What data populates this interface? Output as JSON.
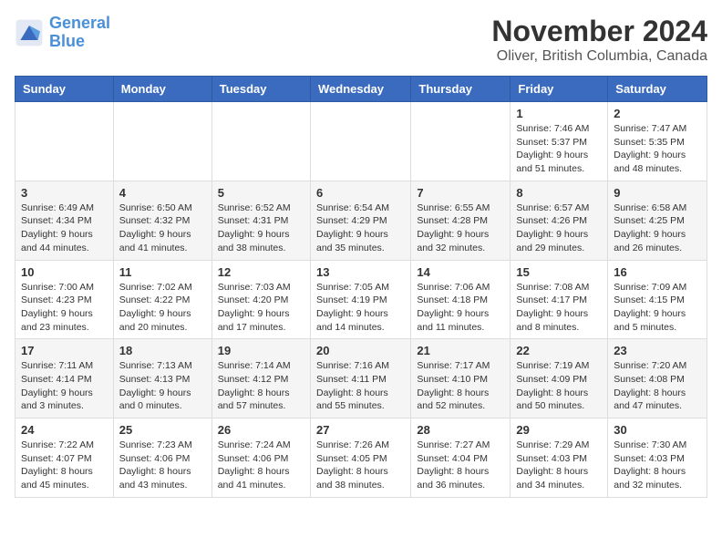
{
  "header": {
    "logo_line1": "General",
    "logo_line2": "Blue",
    "month": "November 2024",
    "location": "Oliver, British Columbia, Canada"
  },
  "weekdays": [
    "Sunday",
    "Monday",
    "Tuesday",
    "Wednesday",
    "Thursday",
    "Friday",
    "Saturday"
  ],
  "weeks": [
    [
      {
        "day": "",
        "info": ""
      },
      {
        "day": "",
        "info": ""
      },
      {
        "day": "",
        "info": ""
      },
      {
        "day": "",
        "info": ""
      },
      {
        "day": "",
        "info": ""
      },
      {
        "day": "1",
        "info": "Sunrise: 7:46 AM\nSunset: 5:37 PM\nDaylight: 9 hours\nand 51 minutes."
      },
      {
        "day": "2",
        "info": "Sunrise: 7:47 AM\nSunset: 5:35 PM\nDaylight: 9 hours\nand 48 minutes."
      }
    ],
    [
      {
        "day": "3",
        "info": "Sunrise: 6:49 AM\nSunset: 4:34 PM\nDaylight: 9 hours\nand 44 minutes."
      },
      {
        "day": "4",
        "info": "Sunrise: 6:50 AM\nSunset: 4:32 PM\nDaylight: 9 hours\nand 41 minutes."
      },
      {
        "day": "5",
        "info": "Sunrise: 6:52 AM\nSunset: 4:31 PM\nDaylight: 9 hours\nand 38 minutes."
      },
      {
        "day": "6",
        "info": "Sunrise: 6:54 AM\nSunset: 4:29 PM\nDaylight: 9 hours\nand 35 minutes."
      },
      {
        "day": "7",
        "info": "Sunrise: 6:55 AM\nSunset: 4:28 PM\nDaylight: 9 hours\nand 32 minutes."
      },
      {
        "day": "8",
        "info": "Sunrise: 6:57 AM\nSunset: 4:26 PM\nDaylight: 9 hours\nand 29 minutes."
      },
      {
        "day": "9",
        "info": "Sunrise: 6:58 AM\nSunset: 4:25 PM\nDaylight: 9 hours\nand 26 minutes."
      }
    ],
    [
      {
        "day": "10",
        "info": "Sunrise: 7:00 AM\nSunset: 4:23 PM\nDaylight: 9 hours\nand 23 minutes."
      },
      {
        "day": "11",
        "info": "Sunrise: 7:02 AM\nSunset: 4:22 PM\nDaylight: 9 hours\nand 20 minutes."
      },
      {
        "day": "12",
        "info": "Sunrise: 7:03 AM\nSunset: 4:20 PM\nDaylight: 9 hours\nand 17 minutes."
      },
      {
        "day": "13",
        "info": "Sunrise: 7:05 AM\nSunset: 4:19 PM\nDaylight: 9 hours\nand 14 minutes."
      },
      {
        "day": "14",
        "info": "Sunrise: 7:06 AM\nSunset: 4:18 PM\nDaylight: 9 hours\nand 11 minutes."
      },
      {
        "day": "15",
        "info": "Sunrise: 7:08 AM\nSunset: 4:17 PM\nDaylight: 9 hours\nand 8 minutes."
      },
      {
        "day": "16",
        "info": "Sunrise: 7:09 AM\nSunset: 4:15 PM\nDaylight: 9 hours\nand 5 minutes."
      }
    ],
    [
      {
        "day": "17",
        "info": "Sunrise: 7:11 AM\nSunset: 4:14 PM\nDaylight: 9 hours\nand 3 minutes."
      },
      {
        "day": "18",
        "info": "Sunrise: 7:13 AM\nSunset: 4:13 PM\nDaylight: 9 hours\nand 0 minutes."
      },
      {
        "day": "19",
        "info": "Sunrise: 7:14 AM\nSunset: 4:12 PM\nDaylight: 8 hours\nand 57 minutes."
      },
      {
        "day": "20",
        "info": "Sunrise: 7:16 AM\nSunset: 4:11 PM\nDaylight: 8 hours\nand 55 minutes."
      },
      {
        "day": "21",
        "info": "Sunrise: 7:17 AM\nSunset: 4:10 PM\nDaylight: 8 hours\nand 52 minutes."
      },
      {
        "day": "22",
        "info": "Sunrise: 7:19 AM\nSunset: 4:09 PM\nDaylight: 8 hours\nand 50 minutes."
      },
      {
        "day": "23",
        "info": "Sunrise: 7:20 AM\nSunset: 4:08 PM\nDaylight: 8 hours\nand 47 minutes."
      }
    ],
    [
      {
        "day": "24",
        "info": "Sunrise: 7:22 AM\nSunset: 4:07 PM\nDaylight: 8 hours\nand 45 minutes."
      },
      {
        "day": "25",
        "info": "Sunrise: 7:23 AM\nSunset: 4:06 PM\nDaylight: 8 hours\nand 43 minutes."
      },
      {
        "day": "26",
        "info": "Sunrise: 7:24 AM\nSunset: 4:06 PM\nDaylight: 8 hours\nand 41 minutes."
      },
      {
        "day": "27",
        "info": "Sunrise: 7:26 AM\nSunset: 4:05 PM\nDaylight: 8 hours\nand 38 minutes."
      },
      {
        "day": "28",
        "info": "Sunrise: 7:27 AM\nSunset: 4:04 PM\nDaylight: 8 hours\nand 36 minutes."
      },
      {
        "day": "29",
        "info": "Sunrise: 7:29 AM\nSunset: 4:03 PM\nDaylight: 8 hours\nand 34 minutes."
      },
      {
        "day": "30",
        "info": "Sunrise: 7:30 AM\nSunset: 4:03 PM\nDaylight: 8 hours\nand 32 minutes."
      }
    ]
  ]
}
